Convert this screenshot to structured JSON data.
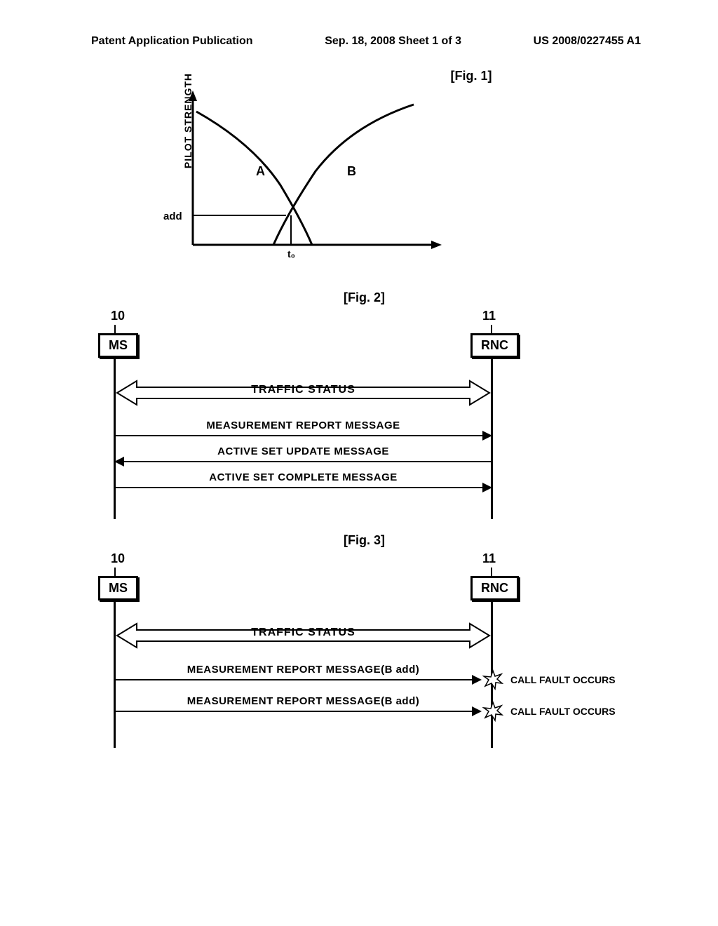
{
  "header": {
    "left": "Patent Application Publication",
    "center": "Sep. 18, 2008 Sheet 1 of 3",
    "right": "US 2008/0227455 A1"
  },
  "fig1": {
    "label": "[Fig. 1]",
    "y_axis": "PILOT STRENGTH",
    "add_label": "add",
    "curve_a": "A",
    "curve_b": "B",
    "t0": "t₀"
  },
  "fig2": {
    "label": "[Fig. 2]",
    "left_num": "10",
    "right_num": "11",
    "left_box": "MS",
    "right_box": "RNC",
    "traffic": "TRAFFIC STATUS",
    "msg1": "MEASUREMENT REPORT MESSAGE",
    "msg2": "ACTIVE SET UPDATE MESSAGE",
    "msg3": "ACTIVE SET COMPLETE MESSAGE"
  },
  "fig3": {
    "label": "[Fig. 3]",
    "left_num": "10",
    "right_num": "11",
    "left_box": "MS",
    "right_box": "RNC",
    "traffic": "TRAFFIC STATUS",
    "msg1": "MEASUREMENT REPORT MESSAGE(B add)",
    "msg2": "MEASUREMENT REPORT MESSAGE(B add)",
    "fault1": "CALL FAULT OCCURS",
    "fault2": "CALL FAULT OCCURS"
  }
}
